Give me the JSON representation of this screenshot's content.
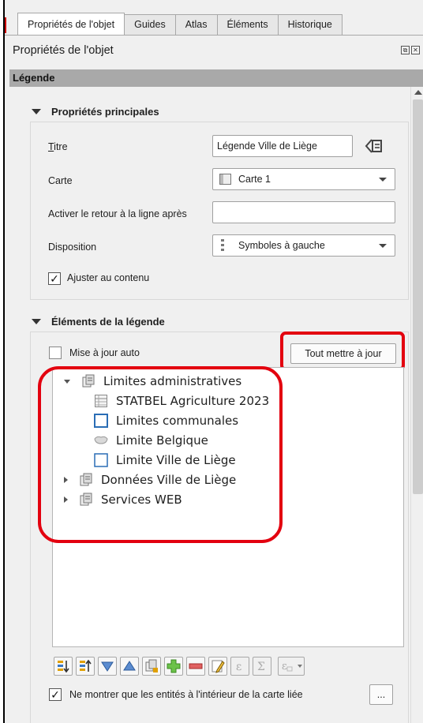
{
  "tabs": [
    {
      "label": "Propriétés de l'objet",
      "active": true
    },
    {
      "label": "Guides",
      "active": false
    },
    {
      "label": "Atlas",
      "active": false
    },
    {
      "label": "Éléments",
      "active": false
    },
    {
      "label": "Historique",
      "active": false
    }
  ],
  "dock": {
    "title": "Propriétés de l'objet"
  },
  "section": {
    "title": "Légende"
  },
  "main_props": {
    "title": "Propriétés principales",
    "titre_label": "Titre",
    "titre_value": "Légende Ville de Liège",
    "carte_label": "Carte",
    "carte_value": "Carte 1",
    "wrap_label": "Activer le retour à la ligne après",
    "wrap_value": "",
    "disposition_label": "Disposition",
    "disposition_value": "Symboles à gauche",
    "fit_label": "Ajuster au contenu",
    "fit_checked": true
  },
  "legend_items": {
    "title": "Éléments de la légende",
    "auto_update_label": "Mise à jour auto",
    "auto_update_checked": false,
    "update_all_label": "Tout mettre à jour",
    "tree": [
      {
        "label": "Limites administratives",
        "type": "group",
        "expanded": true
      },
      {
        "label": "STATBEL Agriculture 2023",
        "type": "table-layer"
      },
      {
        "label": "Limites communales",
        "type": "polygon-layer"
      },
      {
        "label": "Limite Belgique",
        "type": "polygon-layer"
      },
      {
        "label": "Limite Ville de Liège",
        "type": "polygon-layer"
      },
      {
        "label": "Données Ville de Liège",
        "type": "group",
        "expanded": false
      },
      {
        "label": "Services WEB",
        "type": "group",
        "expanded": false
      }
    ],
    "filter_label": "Ne montrer que les entités à l'intérieur de la carte liée",
    "filter_checked": true,
    "more_label": "..."
  },
  "colors": {
    "highlight": "#e3000f",
    "polygon_outline": "#2a6db5"
  }
}
